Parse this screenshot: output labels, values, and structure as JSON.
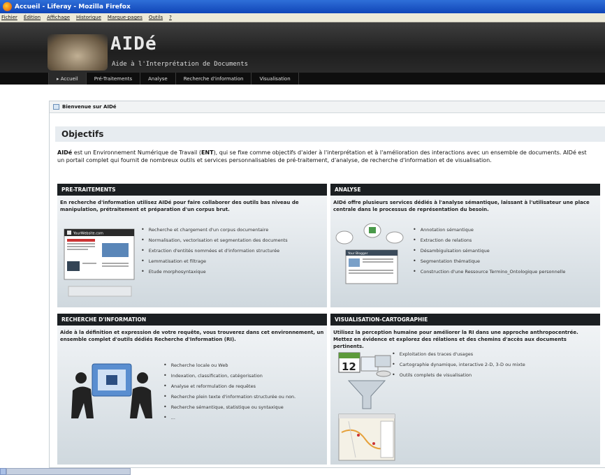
{
  "window": {
    "title": "Accueil - Liferay - Mozilla Firefox"
  },
  "menu": [
    "Fichier",
    "Édition",
    "Affichage",
    "Historique",
    "Marque-pages",
    "Outils",
    "?"
  ],
  "banner": {
    "title": "AIDé",
    "subtitle": "Aide à l'Interprétation de Documents"
  },
  "nav": {
    "tabs": [
      {
        "label": "▸ Accueil"
      },
      {
        "label": "Pré-Traitements"
      },
      {
        "label": "Analyse"
      },
      {
        "label": "Recherche d'information"
      },
      {
        "label": "Visualisation"
      }
    ]
  },
  "portlet": {
    "title": "Bienvenue sur AIDé"
  },
  "objectifs": {
    "heading": "Objectifs",
    "intro_brand": "AIDé",
    "intro_p1": " est un Environnement Numérique de Travail (",
    "intro_ent": "ENT",
    "intro_p2": "), qui se fixe comme objectifs d'aider à l'interprétation et à l'amélioration des interactions avec un ensemble de documents. AIDé est",
    "intro_line2": "un portail complet qui fournit de nombreux outils et services personnalisables de pré-traitement, d'analyse, de recherche d'information et de visualisation."
  },
  "cards": {
    "pretraitements": {
      "title": "PRE-TRAITEMENTS",
      "desc": "En recherche d'information utilisez AIDé pour faire collaborer des outils bas niveau de manipulation, prétraitement et préparation d'un corpus brut.",
      "site_label": "YourWebsite.com",
      "items": [
        "Recherche et chargement d'un corpus documentaire",
        "Normalisation, vectorisation et segmentation des documents",
        "Extraction d'entités nommées et d'information structurée",
        "Lemmatisation et filtrage",
        "Etude morphosyntaxique"
      ]
    },
    "analyse": {
      "title": "ANALYSE",
      "desc": "AIDé offre plusieurs services dédiés à l'analyse sémantique, laissant à l'utilisateur une place centrale dans le processus de représentation du besoin.",
      "blog_label": "Your Blogger",
      "items": [
        "Annotation sémantique",
        "Extraction de relations",
        "Désambiguïsation sémantique",
        "Segmentation thématique",
        "Construction d'une Ressource Termino_Ontologique personnelle"
      ]
    },
    "recherche": {
      "title": "RECHERCHE D'INFORMATION",
      "desc": "Aide à la définition et expression de votre requête, vous trouverez dans cet environnement, un ensemble complet d'outils dédiés Recherche d'Information (RI).",
      "items": [
        "Recherche locale ou Web",
        "Indexation, classification, catégorisation",
        "Analyse et reformulation de requêtes",
        "Recherche plein texte d'information structurée ou non.",
        "Recherche sémantique, statistique ou syntaxique",
        "..."
      ]
    },
    "visualisation": {
      "title": "VISUALISATION-CARTOGRAPHIE",
      "desc": "Utilisez la perception humaine pour améliorer la RI dans une approche anthropocentrée. Mettez en évidence et explorez des rélations et des chemins d'accès aux documents pertinents.",
      "calendar_day": "12",
      "items": [
        "Exploitation des traces d'usages",
        "Cartographie dynamique, interactive 2-D, 3-D ou mixte",
        "Outils complets de visualisation"
      ]
    }
  }
}
